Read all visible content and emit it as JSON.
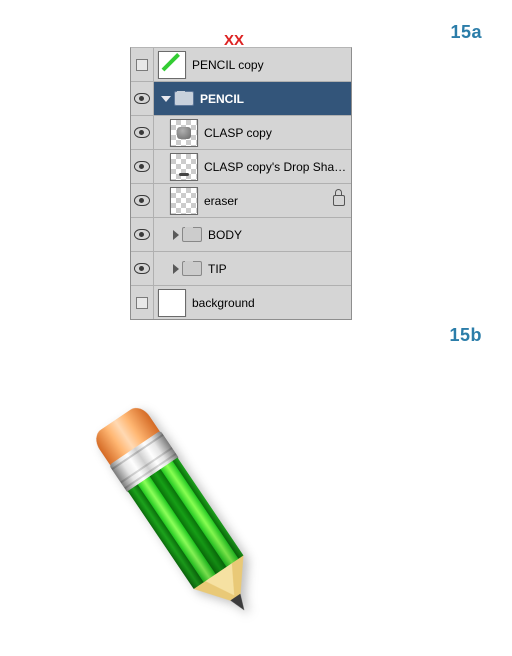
{
  "labels": {
    "step_a": "15a",
    "step_b": "15b",
    "xx": "XX"
  },
  "panel": {
    "rows": [
      {
        "label": "PENCIL copy"
      },
      {
        "label": "PENCIL"
      },
      {
        "label": "CLASP copy"
      },
      {
        "label": "CLASP copy's Drop Shadow"
      },
      {
        "label": "eraser"
      },
      {
        "label": "BODY"
      },
      {
        "label": "TIP"
      },
      {
        "label": "background"
      }
    ]
  }
}
